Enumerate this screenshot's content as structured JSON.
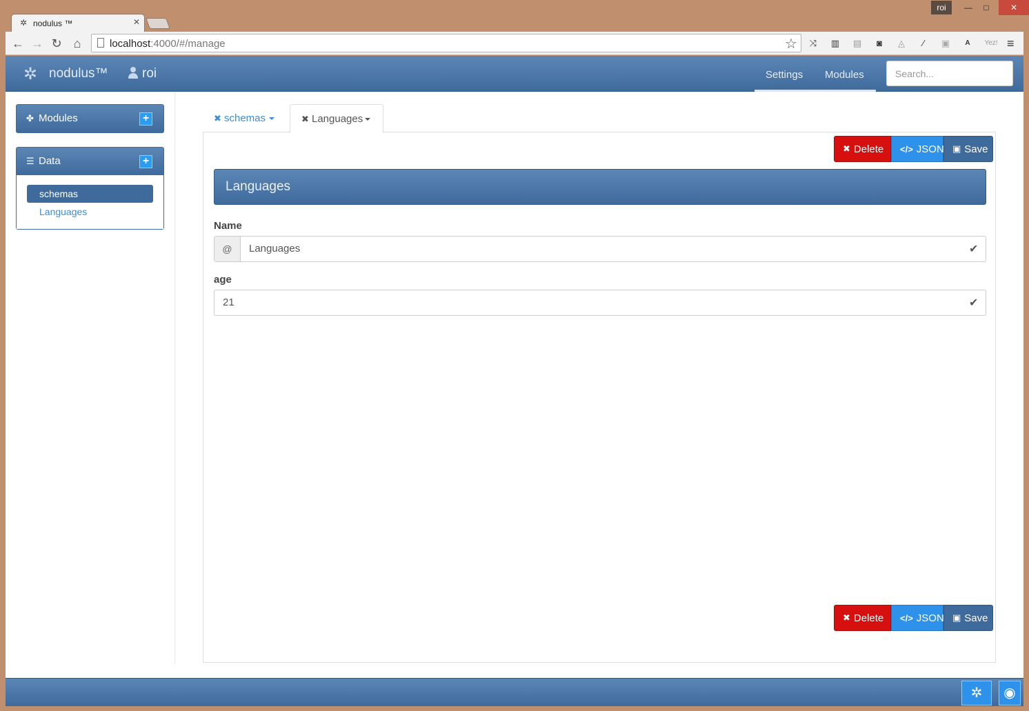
{
  "browser": {
    "os_user": "roi",
    "tab_title": "nodulus ™",
    "url_host": "localhost",
    "url_rest": ":4000/#/manage",
    "window_buttons": {
      "minimize": "—",
      "maximize": "□",
      "close": "✕"
    },
    "extension_icons": [
      "share-arrows-icon",
      "piano-icon",
      "ruler-icon",
      "lightbulb-icon",
      "angular-icon",
      "magic-wand-icon",
      "camera-icon",
      "a-circle-icon",
      "yez-icon"
    ],
    "extension_labels": {
      "a": "A",
      "yez": "Yez!"
    }
  },
  "navbar": {
    "brand": "nodulus™",
    "user": "roi",
    "links": {
      "settings": "Settings",
      "modules": "Modules"
    },
    "search_placeholder": "Search..."
  },
  "sidebar": {
    "modules": {
      "title": "Modules",
      "add": "+"
    },
    "data": {
      "title": "Data",
      "add": "+",
      "items": [
        {
          "label": "schemas",
          "active": true
        },
        {
          "label": "Languages",
          "active": false
        }
      ]
    }
  },
  "main": {
    "tabs": [
      {
        "label": "schemas",
        "active": false
      },
      {
        "label": "Languages",
        "active": true
      }
    ],
    "buttons": {
      "delete": "Delete",
      "json": "JSON",
      "save": "Save"
    },
    "form": {
      "title": "Languages",
      "fields": [
        {
          "label": "Name",
          "addon": "@",
          "value": "Languages"
        },
        {
          "label": "age",
          "value": "21"
        }
      ]
    }
  },
  "colors": {
    "primary": "#3f6b9c",
    "danger": "#d60f0f",
    "info": "#2e92ea"
  }
}
